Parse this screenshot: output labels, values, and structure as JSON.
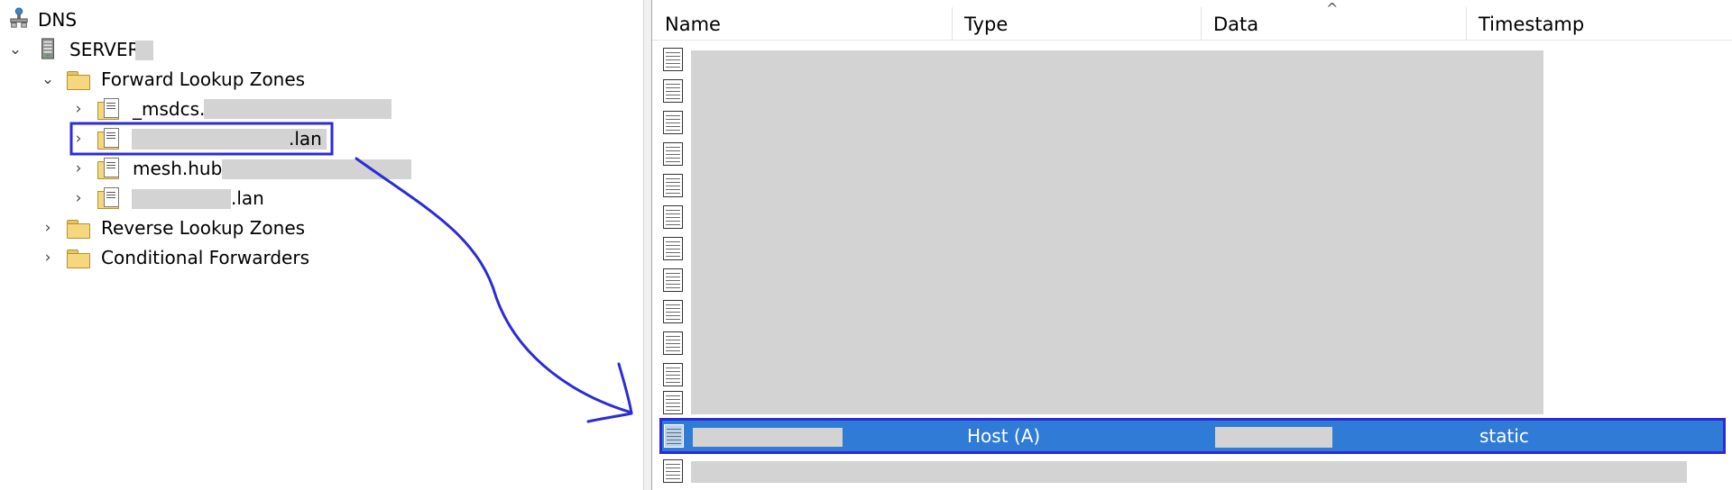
{
  "tree": {
    "root": {
      "label": "DNS",
      "icon": "dns-manager-icon"
    },
    "server": {
      "label": "SERVER",
      "icon": "server-icon",
      "chevron": "⌄"
    },
    "forward_zones": {
      "label": "Forward Lookup Zones",
      "icon": "folder-icon",
      "chevron": "⌄"
    },
    "zones": [
      {
        "label": "_msdcs.",
        "icon": "zone-icon",
        "chevron": "›"
      },
      {
        "label": ".lan",
        "icon": "zone-icon",
        "chevron": "›",
        "selected": true
      },
      {
        "label": "mesh.hub",
        "icon": "zone-icon",
        "chevron": "›"
      },
      {
        "label": ".lan",
        "icon": "zone-icon",
        "chevron": "›"
      }
    ],
    "reverse_zones": {
      "label": "Reverse Lookup Zones",
      "icon": "folder-icon",
      "chevron": "›"
    },
    "conditional_forwarders": {
      "label": "Conditional Forwarders",
      "icon": "folder-icon",
      "chevron": "›"
    }
  },
  "list": {
    "columns": [
      "Name",
      "Type",
      "Data",
      "Timestamp"
    ],
    "sort_indicator": "^",
    "selected_record": {
      "name": "",
      "type": "Host (A)",
      "data": "",
      "timestamp": "static",
      "icon": "dns-record-icon"
    }
  },
  "colors": {
    "selection_fill": "#2f7bd5",
    "annotation_stroke": "#2b2bd9",
    "redaction": "#d3d3d3"
  }
}
